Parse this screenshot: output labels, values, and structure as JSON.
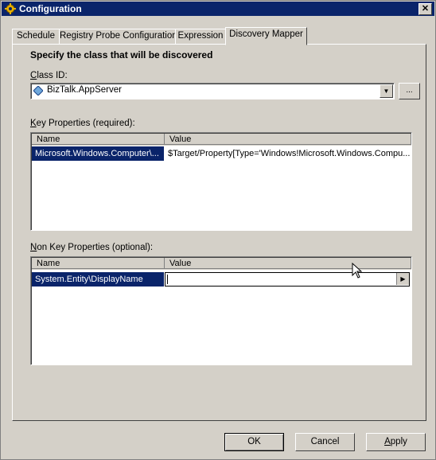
{
  "window": {
    "title": "Configuration",
    "close_glyph": "✕"
  },
  "tabs": [
    {
      "label": "Schedule"
    },
    {
      "label": "Registry Probe Configuration"
    },
    {
      "label": "Expression"
    },
    {
      "label": "Discovery Mapper",
      "active": true
    }
  ],
  "panel": {
    "heading": "Specify the class that will be discovered",
    "class_id": {
      "label_prefix": "C",
      "label_rest": "lass ID:",
      "value": "BizTalk.AppServer",
      "browse_label": "..."
    },
    "key_properties": {
      "label_prefix": "K",
      "label_rest": "ey Properties (required):",
      "columns": [
        "Name",
        "Value"
      ],
      "rows": [
        {
          "name": "Microsoft.Windows.Computer\\...",
          "value": "$Target/Property[Type='Windows!Microsoft.Windows.Compu..."
        }
      ]
    },
    "non_key_properties": {
      "label_prefix": "N",
      "label_rest": "on Key Properties (optional):",
      "columns": [
        "Name",
        "Value"
      ],
      "rows": [
        {
          "name": "System.Entity\\DisplayName",
          "value": ""
        }
      ]
    }
  },
  "buttons": {
    "ok": "OK",
    "cancel": "Cancel",
    "apply_prefix": "A",
    "apply_rest": "pply"
  },
  "colors": {
    "selection": "#0a246a",
    "face": "#d4d0c8"
  },
  "icons": {
    "app": "gear-icon",
    "class": "class-diamond-icon"
  }
}
